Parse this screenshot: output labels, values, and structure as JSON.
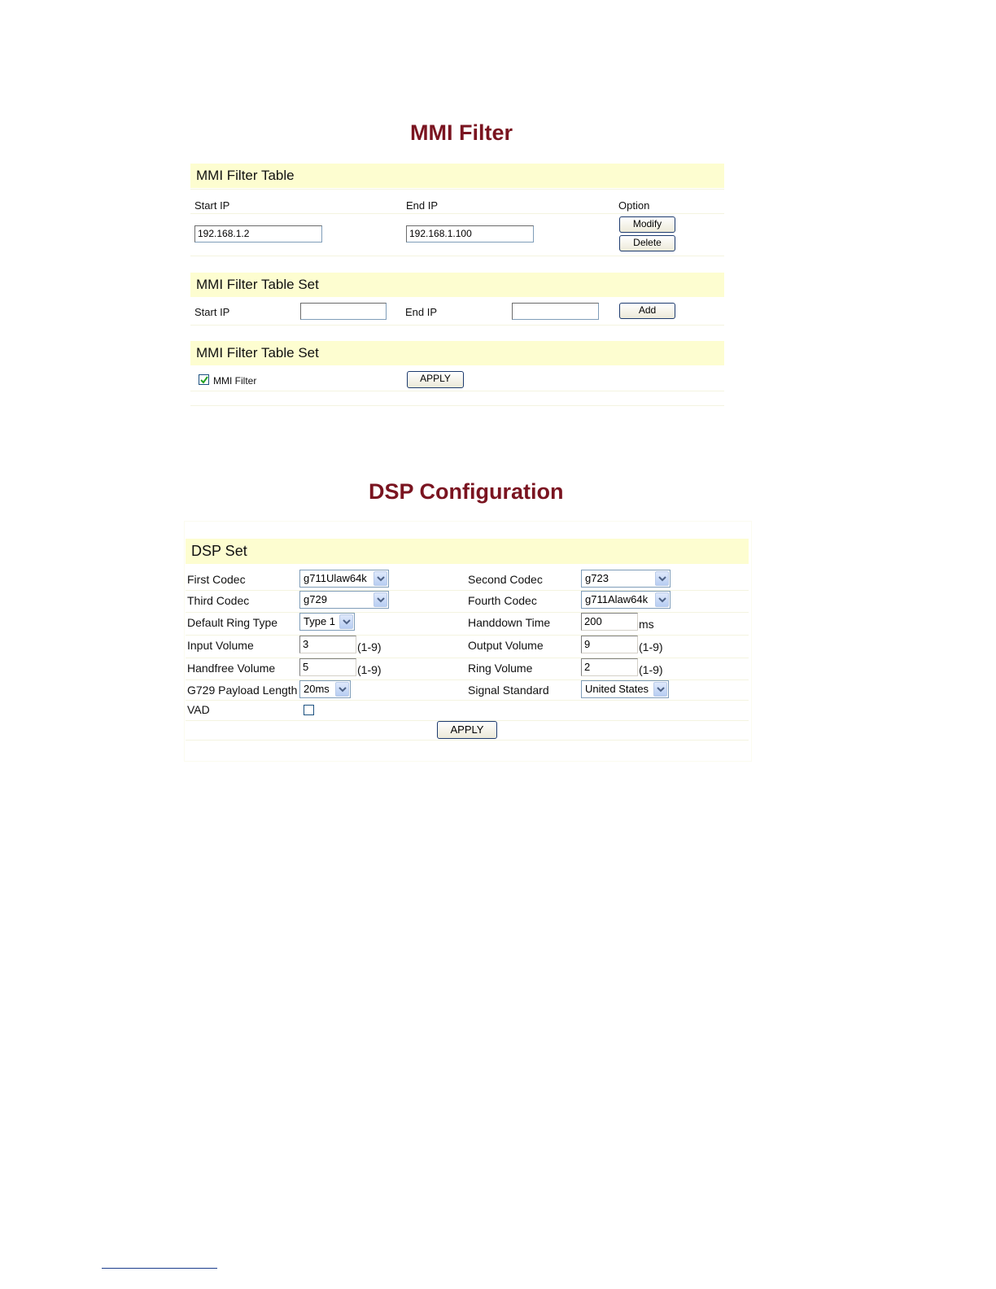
{
  "mmi": {
    "title": "MMI Filter",
    "table": {
      "header": "MMI Filter Table",
      "col_start": "Start IP",
      "col_end": "End IP",
      "col_option": "Option",
      "row": {
        "start_ip": "192.168.1.2",
        "end_ip": "192.168.1.100"
      },
      "modify_label": "Modify",
      "delete_label": "Delete"
    },
    "table_set": {
      "header": "MMI Filter Table Set",
      "start_label": "Start IP",
      "end_label": "End IP",
      "start_value": "",
      "end_value": "",
      "add_label": "Add"
    },
    "enable_set": {
      "header": "MMI Filter Table Set",
      "checkbox_label": "MMI Filter",
      "checked": true,
      "apply_label": "APPLY"
    }
  },
  "dsp": {
    "title": "DSP Configuration",
    "header": "DSP Set",
    "first_codec": {
      "label": "First Codec",
      "value": "g711Ulaw64k"
    },
    "second_codec": {
      "label": "Second Codec",
      "value": "g723"
    },
    "third_codec": {
      "label": "Third Codec",
      "value": "g729"
    },
    "fourth_codec": {
      "label": "Fourth Codec",
      "value": "g711Alaw64k"
    },
    "ring_type": {
      "label": "Default Ring Type",
      "value": "Type 1"
    },
    "handdown_time": {
      "label": "Handdown Time",
      "value": "200",
      "unit": "ms"
    },
    "input_volume": {
      "label": "Input Volume",
      "value": "3",
      "range": "(1-9)"
    },
    "output_volume": {
      "label": "Output Volume",
      "value": "9",
      "range": "(1-9)"
    },
    "handfree_volume": {
      "label": "Handfree Volume",
      "value": "5",
      "range": "(1-9)"
    },
    "ring_volume": {
      "label": "Ring Volume",
      "value": "2",
      "range": "(1-9)"
    },
    "payload_length": {
      "label": "G729 Payload Length",
      "value": "20ms"
    },
    "signal_standard": {
      "label": "Signal Standard",
      "value": "United States"
    },
    "vad": {
      "label": "VAD",
      "checked": false
    },
    "apply_label": "APPLY"
  },
  "colors": {
    "title": "#7a1420",
    "header_bar": "#fdfdd0",
    "button_border": "#1c3a6e"
  }
}
